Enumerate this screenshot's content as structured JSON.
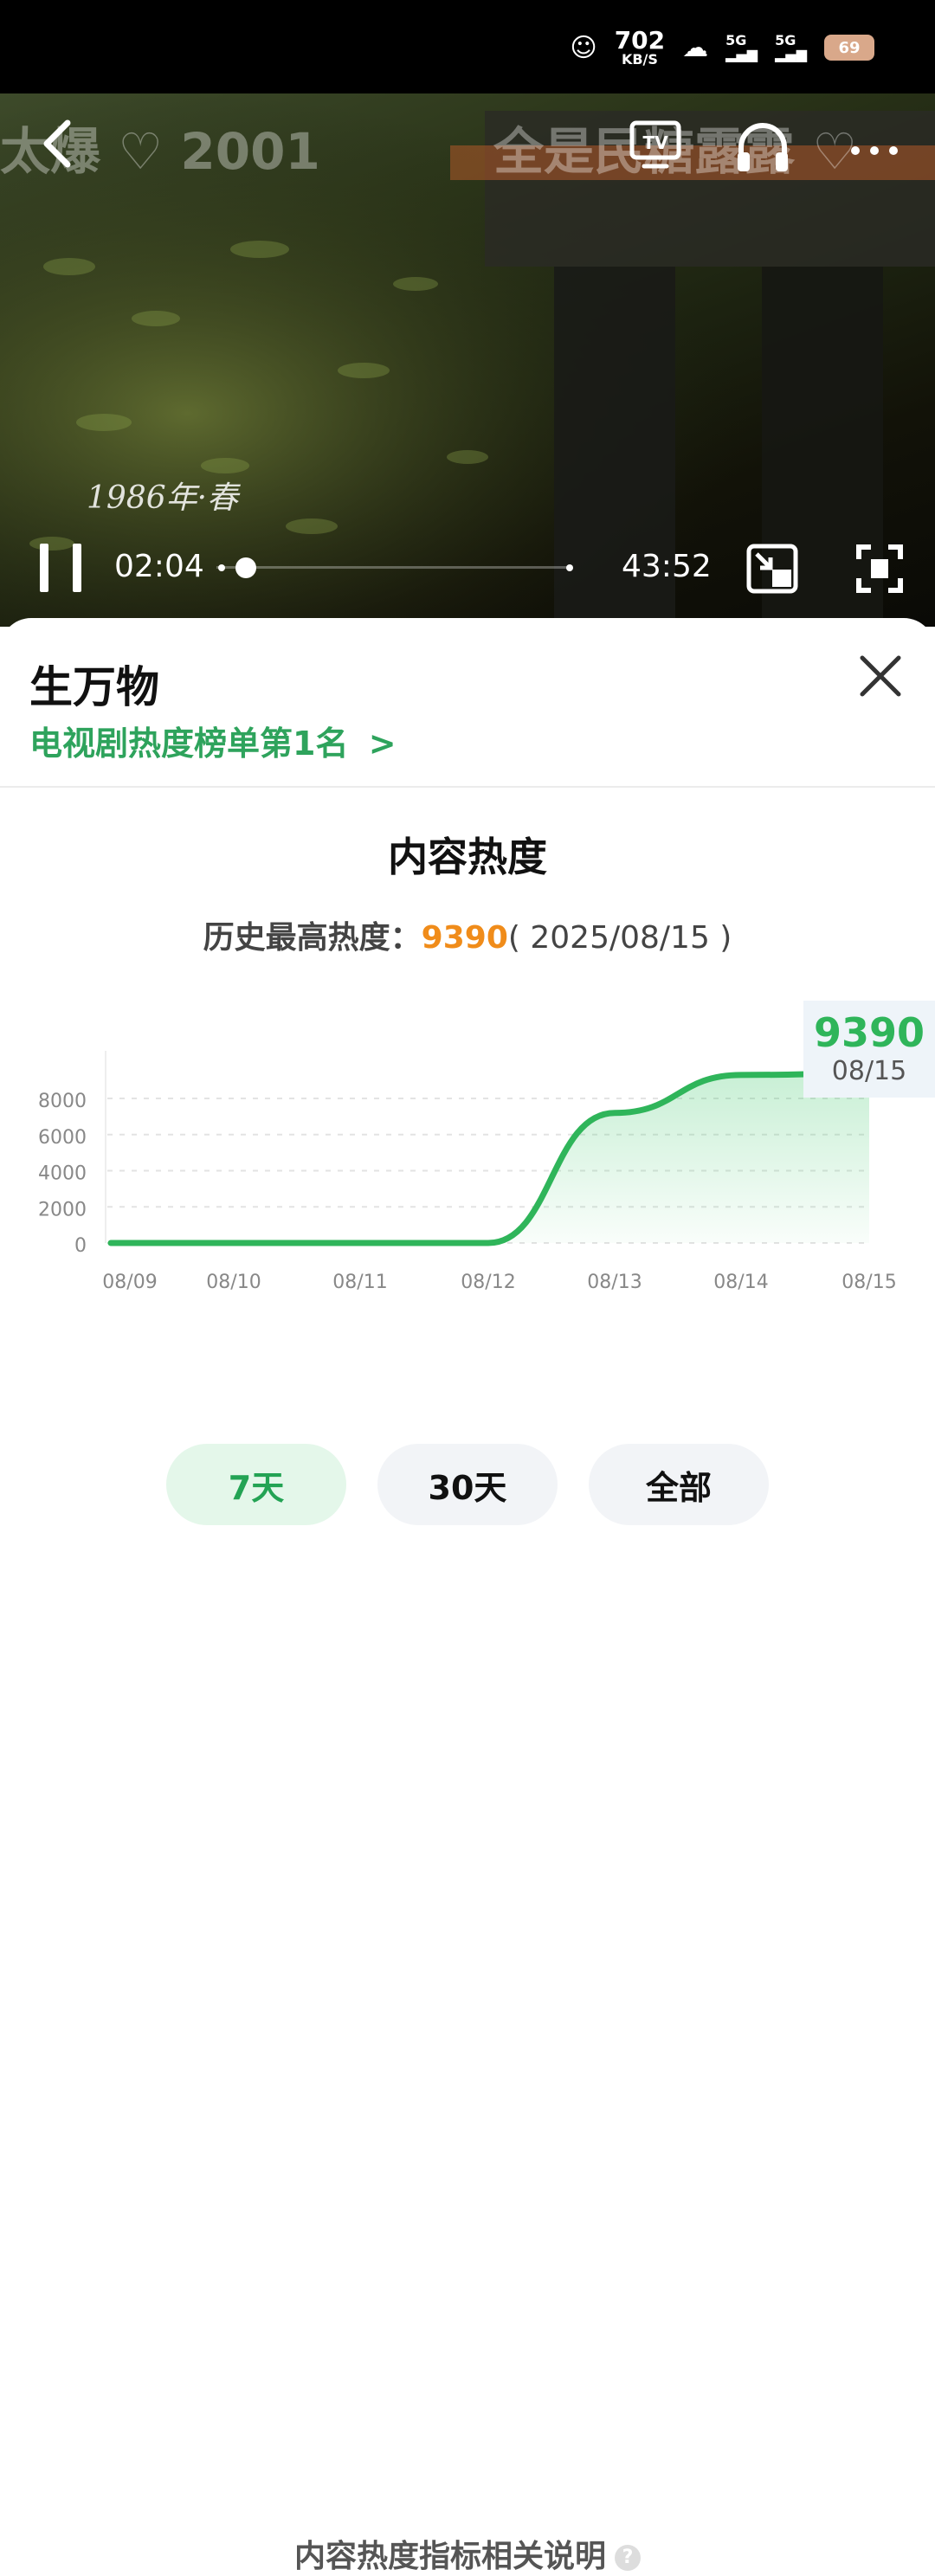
{
  "status_bar": {
    "net_speed": "702",
    "net_unit": "KB/S",
    "signal_1": "5G",
    "signal_2": "5G",
    "battery": "69"
  },
  "video": {
    "overlay_left": "太爆 ♡ 2001",
    "overlay_right": "全是民糖露露 ♡",
    "year_caption": "1986年·春",
    "current_time": "02:04",
    "total_time": "43:52",
    "progress": 0.047
  },
  "sheet": {
    "title": "生万物",
    "rank_text": "电视剧热度榜单第1名",
    "rank_arrow": ">",
    "section_title": "内容热度",
    "peak_label": "历史最高热度：",
    "peak_value": "9390",
    "peak_date": "( 2025/08/15 )",
    "tooltip_value": "9390",
    "tooltip_date": "08/15",
    "ranges": [
      "7天",
      "30天",
      "全部"
    ],
    "footer_text": "内容热度指标相关说明",
    "help_glyph": "?"
  },
  "colors": {
    "accent_green": "#2fb55a",
    "peak_orange": "#f08c1a",
    "active_pill_bg": "#e4f7ea"
  },
  "chart_data": {
    "type": "area",
    "x": [
      "08/09",
      "08/10",
      "08/11",
      "08/12",
      "08/13",
      "08/14",
      "08/15"
    ],
    "series": [
      {
        "values": [
          0,
          0,
          0,
          0,
          7200,
          9300,
          9390
        ]
      }
    ],
    "yticks": [
      0,
      2000,
      4000,
      6000,
      8000
    ],
    "ylim": [
      0,
      9390
    ],
    "grid": true
  }
}
